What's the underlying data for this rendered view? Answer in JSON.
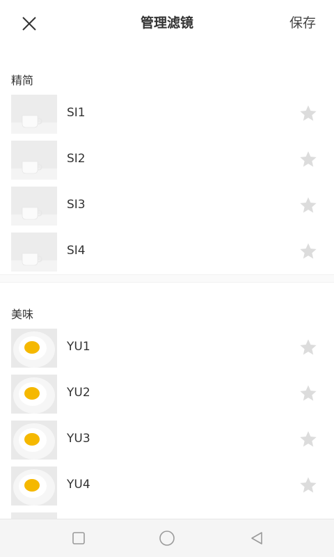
{
  "header": {
    "title": "管理滤镜",
    "save_label": "保存",
    "close_icon": "close-icon"
  },
  "sections": [
    {
      "title": "精简",
      "items": [
        {
          "label": "SI1",
          "thumb": "cup"
        },
        {
          "label": "SI2",
          "thumb": "cup"
        },
        {
          "label": "SI3",
          "thumb": "cup"
        },
        {
          "label": "SI4",
          "thumb": "cup"
        }
      ]
    },
    {
      "title": "美味",
      "items": [
        {
          "label": "YU1",
          "thumb": "egg"
        },
        {
          "label": "YU2",
          "thumb": "egg"
        },
        {
          "label": "YU3",
          "thumb": "egg"
        },
        {
          "label": "YU4",
          "thumb": "egg"
        }
      ]
    }
  ],
  "colors": {
    "star": "#dcdcdc",
    "egg_yolk": "#f5b800",
    "egg_white": "#ffffff",
    "cup": "#f7f7f7",
    "nav_icon": "#9a9a9a"
  },
  "navbar": {
    "icons": [
      "square-icon",
      "circle-icon",
      "back-triangle-icon"
    ]
  }
}
